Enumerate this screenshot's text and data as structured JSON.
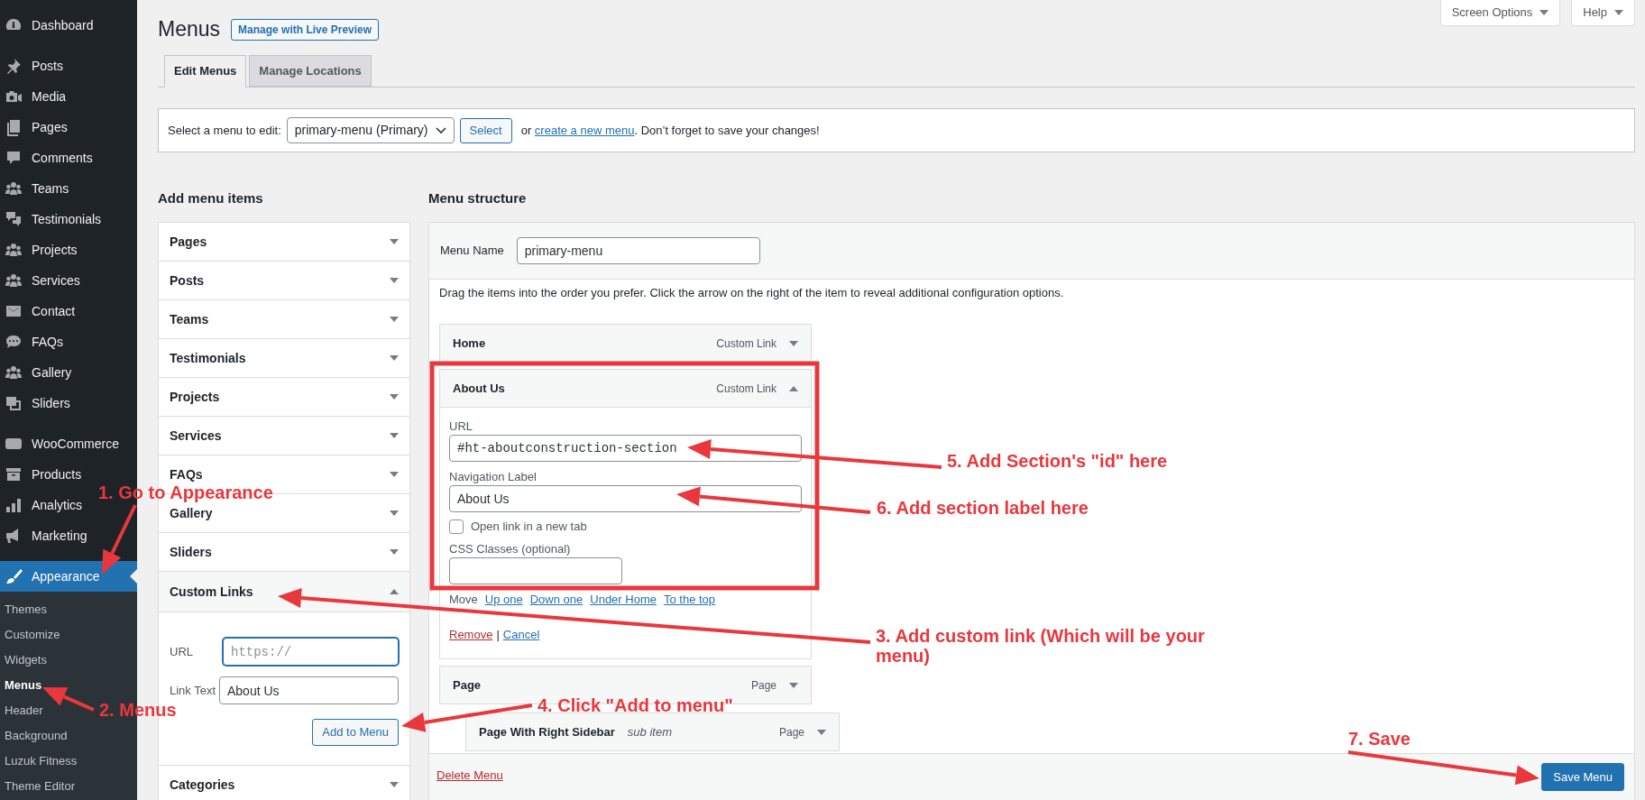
{
  "sidebar": {
    "groups": [
      {
        "items": [
          {
            "label": "Dashboard",
            "selected": false
          }
        ]
      },
      {
        "items": [
          {
            "label": "Posts",
            "selected": false
          },
          {
            "label": "Media",
            "selected": false
          },
          {
            "label": "Pages",
            "selected": false
          },
          {
            "label": "Comments",
            "selected": false
          },
          {
            "label": "Teams",
            "selected": false
          },
          {
            "label": "Testimonials",
            "selected": false
          },
          {
            "label": "Projects",
            "selected": false
          },
          {
            "label": "Services",
            "selected": false
          },
          {
            "label": "Contact",
            "selected": false
          },
          {
            "label": "FAQs",
            "selected": false
          },
          {
            "label": "Gallery",
            "selected": false
          },
          {
            "label": "Sliders",
            "selected": false
          }
        ]
      },
      {
        "items": [
          {
            "label": "WooCommerce",
            "selected": false
          },
          {
            "label": "Products",
            "selected": false
          },
          {
            "label": "Analytics",
            "selected": false
          },
          {
            "label": "Marketing",
            "selected": false
          }
        ]
      },
      {
        "items": [
          {
            "label": "Appearance",
            "selected": true,
            "children": [
              {
                "label": "Themes",
                "selected": false
              },
              {
                "label": "Customize",
                "selected": false
              },
              {
                "label": "Widgets",
                "selected": false
              },
              {
                "label": "Menus",
                "selected": true
              },
              {
                "label": "Header",
                "selected": false
              },
              {
                "label": "Background",
                "selected": false
              },
              {
                "label": "Luzuk Fitness",
                "selected": false
              },
              {
                "label": "Theme Editor",
                "selected": false
              }
            ]
          }
        ]
      }
    ]
  },
  "header": {
    "title": "Menus",
    "action": "Manage with Live Preview",
    "screen_options": "Screen Options",
    "help": "Help"
  },
  "tabs": [
    {
      "label": "Edit Menus",
      "selected": true
    },
    {
      "label": "Manage Locations",
      "selected": false
    }
  ],
  "menu_select": {
    "label": "Select a menu to edit:",
    "value": "primary-menu (Primary)",
    "button": "Select",
    "note_before": "or ",
    "note_link": "create a new menu",
    "note_after": ". Don’t forget to save your changes!"
  },
  "add_menu_items": {
    "heading": "Add menu items",
    "sections": [
      {
        "title": "Pages",
        "expanded": false
      },
      {
        "title": "Posts",
        "expanded": false
      },
      {
        "title": "Teams",
        "expanded": false
      },
      {
        "title": "Testimonials",
        "expanded": false
      },
      {
        "title": "Projects",
        "expanded": false
      },
      {
        "title": "Services",
        "expanded": false
      },
      {
        "title": "FAQs",
        "expanded": false
      },
      {
        "title": "Gallery",
        "expanded": false
      },
      {
        "title": "Sliders",
        "expanded": false
      },
      {
        "title": "Custom Links",
        "expanded": true,
        "fields": [
          {
            "label": "URL",
            "placeholder": "https://",
            "focused": true
          },
          {
            "label": "Link Text",
            "value": "About Us",
            "focused": false
          }
        ],
        "button": "Add to Menu"
      },
      {
        "title": "Categories",
        "expanded": false
      }
    ]
  },
  "menu_structure": {
    "heading": "Menu structure",
    "name_label": "Menu Name",
    "name_value": "primary-menu",
    "instructions": "Drag the items into the order you prefer. Click the arrow on the right of the item to reveal additional configuration options.",
    "items": [
      {
        "title": "Home",
        "type": "Custom Link",
        "expanded": false
      },
      {
        "title": "About Us",
        "type": "Custom Link",
        "expanded": true,
        "settings": {
          "url_label": "URL",
          "url": "#ht-aboutconstruction-section",
          "nav_label": "Navigation Label",
          "nav_value": "About Us",
          "new_tab_label": "Open link in a new tab",
          "new_tab_checked": false,
          "css_label": "CSS Classes (optional)",
          "move_label": "Move",
          "move_links": [
            "Up one",
            "Down one",
            "Under Home",
            "To the top"
          ],
          "remove": "Remove",
          "separator": "|",
          "cancel": "Cancel"
        }
      },
      {
        "title": "Page",
        "type": "Page",
        "expanded": false,
        "children": [
          {
            "title": "Page With Right Sidebar",
            "note": "sub item",
            "type": "Page",
            "expanded": false
          }
        ]
      }
    ],
    "delete": "Delete Menu",
    "save": "Save Menu"
  },
  "annotations": [
    {
      "text": "1. Go to Appearance"
    },
    {
      "text": "2. Menus"
    },
    {
      "text": "3. Add custom link (Which will be your menu)"
    },
    {
      "text": "4. Click \"Add to menu\""
    },
    {
      "text": "5. Add Section's \"id\" here"
    },
    {
      "text": "6. Add section label here"
    },
    {
      "text": "7. Save"
    }
  ]
}
